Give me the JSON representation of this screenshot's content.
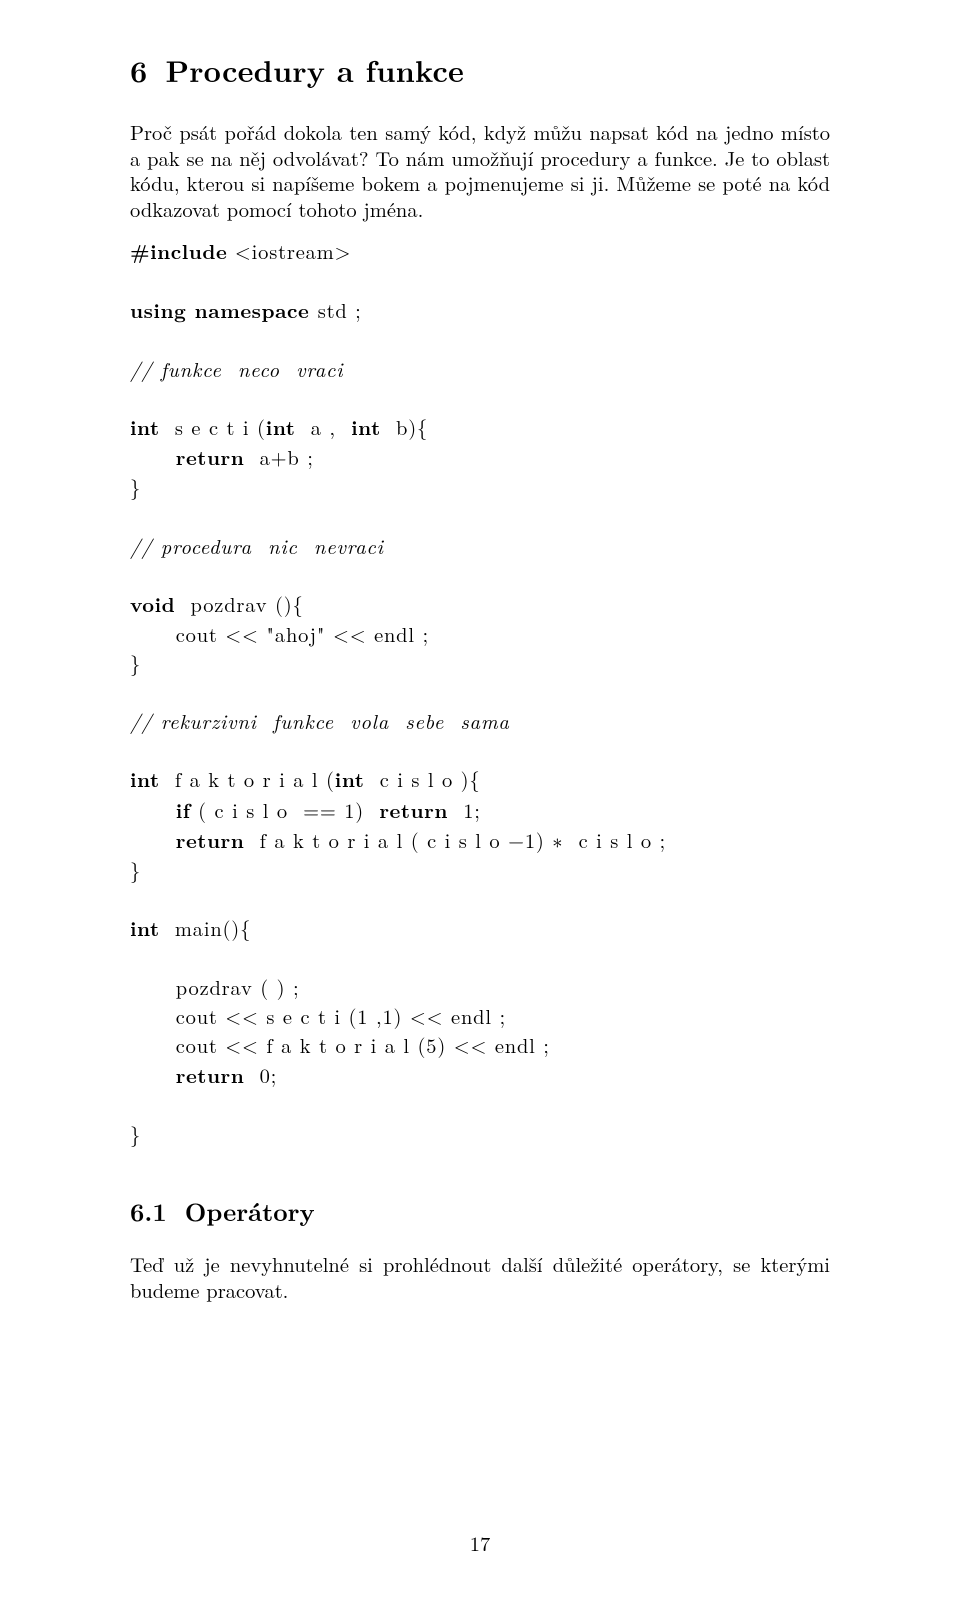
{
  "section": {
    "number": "6",
    "title": "Procedury a funkce"
  },
  "intro": "Proč psát pořád dokola ten samý kód, když můžu napsat kód na jedno místo a pak se na něj odvolávat? To nám umožňují procedury a funkce. Je to oblast kódu, kterou si napíšeme bokem a pojmenujeme si ji. Můžeme se poté na kód odkazovat pomocí tohoto jména.",
  "code": {
    "l1a": "#include",
    "l1b": " <iostream>",
    "l2a": "using namespace ",
    "l2b": "std ;",
    "l3": "// funkce  neco  vraci",
    "l4a": "int",
    "l4b": "  s e c t i (",
    "l4c": "int",
    "l4d": "  a ,  ",
    "l4e": "int",
    "l4f": "  b){",
    "l5a": "      ",
    "l5b": "return",
    "l5c": "  a+b ;",
    "l6": "}",
    "l7": "// procedura  nic  nevraci",
    "l8a": "void",
    "l8b": "  pozdrav (){",
    "l9a": "      cout << \"ahoj\" << endl ;",
    "l10": "}",
    "l11": "// rekurzivni  funkce  vola  sebe  sama",
    "l12a": "int",
    "l12b": "  f a k t o r i a l (",
    "l12c": "int",
    "l12d": "  c i s l o ){",
    "l13a": "      ",
    "l13b": "if",
    "l13c": " ( c i s l o  == 1)  ",
    "l13d": "return",
    "l13e": "  1;",
    "l14a": "      ",
    "l14b": "return",
    "l14c": "  f a k t o r i a l ( c i s l o −1) ∗  c i s l o ;",
    "l15": "}",
    "l16a": "int",
    "l16b": "  main(){",
    "l17": "      pozdrav ( ) ;",
    "l18": "      cout << s e c t i (1 ,1) << endl ;",
    "l19": "      cout << f a k t o r i a l (5) << endl ;",
    "l20a": "      ",
    "l20b": "return",
    "l20c": "  0;",
    "l21": "}"
  },
  "subsection": {
    "number": "6.1",
    "title": "Operátory"
  },
  "subsection_text": "Teď už je nevyhnutelné si prohlédnout další důležité operátory, se kterými budeme pracovat.",
  "page_number": "17"
}
